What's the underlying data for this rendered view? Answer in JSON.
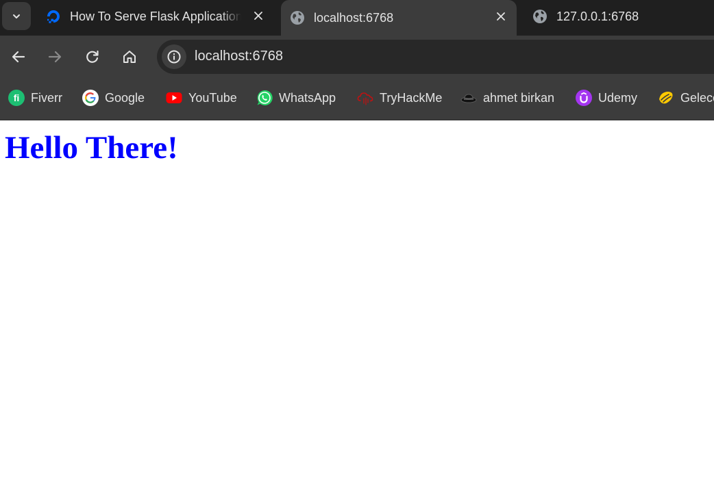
{
  "tabs": [
    {
      "title": "How To Serve Flask Applications with Gunicorn",
      "active": false,
      "icon": "digitalocean-icon"
    },
    {
      "title": "localhost:6768",
      "active": true,
      "icon": "globe-icon"
    },
    {
      "title": "127.0.0.1:6768",
      "active": false,
      "icon": "globe-icon"
    }
  ],
  "toolbar": {
    "url": "localhost:6768",
    "back_icon": "arrow-left-icon",
    "forward_icon": "arrow-right-icon",
    "reload_icon": "reload-icon",
    "home_icon": "home-icon",
    "site_info_icon": "info-icon"
  },
  "bookmarks": [
    {
      "label": "Fiverr",
      "icon": "fiverr-icon",
      "color": "#1dbf73"
    },
    {
      "label": "Google",
      "icon": "google-icon",
      "color": "#4285f4"
    },
    {
      "label": "YouTube",
      "icon": "youtube-icon",
      "color": "#ff0000"
    },
    {
      "label": "WhatsApp",
      "icon": "whatsapp-icon",
      "color": "#25d366"
    },
    {
      "label": "TryHackMe",
      "icon": "tryhackme-icon",
      "color": "#c11111"
    },
    {
      "label": "ahmet birkan",
      "icon": "hat-icon",
      "color": "#111111"
    },
    {
      "label": "Udemy",
      "icon": "udemy-icon",
      "color": "#a435f0"
    },
    {
      "label": "Gelecek",
      "icon": "turkcell-icon",
      "color": "#ffc900"
    }
  ],
  "page": {
    "heading": "Hello There!",
    "heading_color": "#0000ff"
  }
}
